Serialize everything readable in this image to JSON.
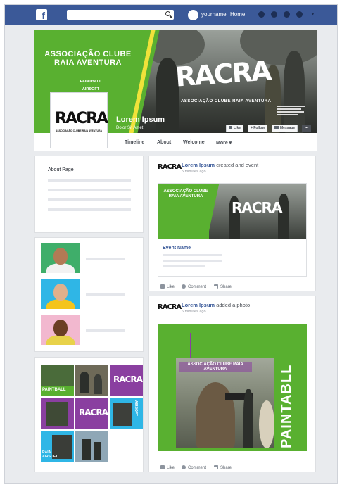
{
  "topbar": {
    "logo": "f",
    "search_placeholder": "",
    "username": "yourname",
    "home": "Home",
    "icons": [
      "friends-icon",
      "messages-icon",
      "notifications-icon",
      "help-icon",
      "dropdown-icon"
    ],
    "color": "#3b5998"
  },
  "cover": {
    "club_title": "ASSOCIAÇÃO CLUBE RAIA AVENTURA",
    "activities": "PAINTBALL\nAIRSOFT",
    "brand": "RACRA",
    "brand_sub": "ASSOCIAÇÃO CLUBE RAIA AVENTURA",
    "page_name": "Lorem Ipsum",
    "page_sub": "Dolor Sit Amet",
    "buttons": {
      "like": "Like",
      "follow": "+ Follow",
      "message": "Message",
      "more": "•••"
    },
    "nav": [
      "Timeline",
      "About",
      "Welcome",
      "More ▾"
    ],
    "accent": "#59b030"
  },
  "left": {
    "about_title": "About Page"
  },
  "posts": [
    {
      "author": "Lorem Ipsum",
      "action": "created and event",
      "time": "5 minutes ago",
      "event_name": "Event Name",
      "image_title": "ASSOCIAÇÃO CLUBE RAIA AVENTURA",
      "image_brand": "RACRA",
      "like": "Like",
      "comment": "Comment",
      "share": "Share"
    },
    {
      "author": "Lorem Ipsum",
      "action": "added a photo",
      "time": "6 minutes ago",
      "image_title": "ASSOCIAÇÃO CLUBE RAIA AVENTURA",
      "image_side": "PAINTABLL",
      "like": "Like",
      "comment": "Comment",
      "share": "Share"
    }
  ],
  "grid": {
    "labels": [
      "PAINTBALL",
      "RACRA",
      "AIRSOFT",
      "RAIA AIRSOFT"
    ]
  }
}
